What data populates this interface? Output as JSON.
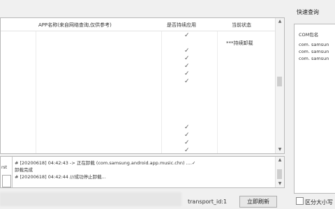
{
  "list": {
    "headers": {
      "app_name": "APP名称(来自网络查询,仅供参考)",
      "is_system": "是否持续应用",
      "status": "当前状态"
    },
    "rows": [
      {
        "check": "✓",
        "status": ""
      },
      {
        "check": "",
        "status": "***持续卸载"
      },
      {
        "check": "✓",
        "status": ""
      },
      {
        "check": "✓",
        "status": ""
      },
      {
        "check": "✓",
        "status": ""
      },
      {
        "check": "✓",
        "status": ""
      },
      {
        "check": "✓",
        "status": ""
      },
      {
        "check": "",
        "status": ""
      },
      {
        "check": "",
        "status": ""
      },
      {
        "check": "",
        "status": ""
      },
      {
        "check": "",
        "status": ""
      },
      {
        "check": "",
        "status": ""
      },
      {
        "check": "✓",
        "status": ""
      },
      {
        "check": "✓",
        "status": ""
      },
      {
        "check": "✓",
        "status": ""
      },
      {
        "check": "✓",
        "status": ""
      }
    ]
  },
  "log": {
    "left_fragment": "rst",
    "lines": [
      "# [20200618] 04:42:43 -> 正在卸载 (com.samsung.android.app.music.chn) ....✓",
      "卸载完成",
      "# [20200618] 04:42:44 ///成功停止卸载..."
    ]
  },
  "footer": {
    "transport": "transport_id:1",
    "refresh_button": "立即刷新"
  },
  "quick": {
    "title": "快速查询",
    "header": "COM包名",
    "lines": [
      "com. samsun",
      "com. samsun",
      "com. samsun"
    ],
    "case_label": "区分大小写"
  }
}
